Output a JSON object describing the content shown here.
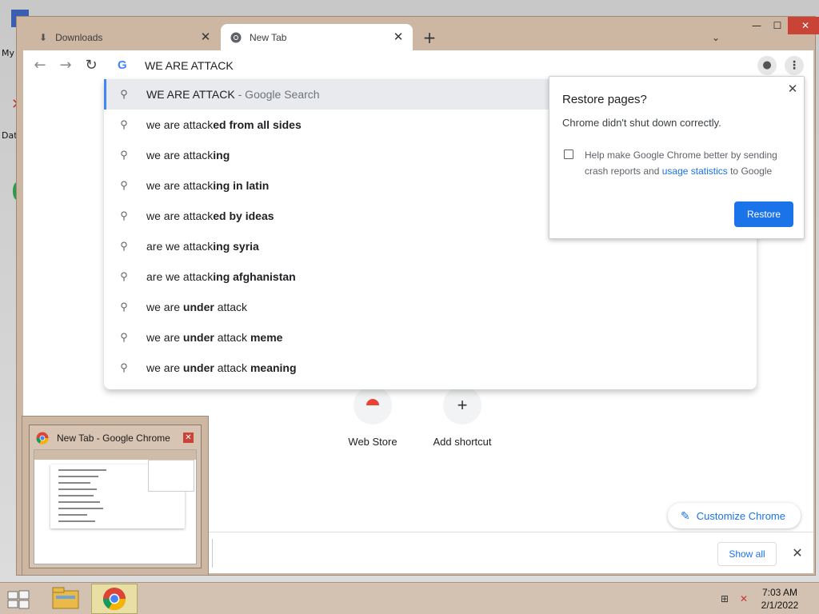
{
  "desktop": {
    "icon_labels": [
      "My",
      "Dat"
    ]
  },
  "window": {
    "tabs": [
      {
        "label": "Downloads",
        "icon": "download-icon"
      },
      {
        "label": "New Tab",
        "icon": "chrome-icon"
      }
    ],
    "controls": {
      "min": "—",
      "max": "☐",
      "close": "✕"
    }
  },
  "toolbar": {
    "omnibox_value": "WE ARE ATTACK"
  },
  "suggestions": [
    {
      "parts": [
        {
          "t": "WE ARE ATTACK",
          "b": false
        }
      ],
      "suffix": " - Google Search",
      "selected": true
    },
    {
      "parts": [
        {
          "t": "we are attack",
          "b": false
        },
        {
          "t": "ed from all sides",
          "b": true
        }
      ]
    },
    {
      "parts": [
        {
          "t": "we are attack",
          "b": false
        },
        {
          "t": "ing",
          "b": true
        }
      ]
    },
    {
      "parts": [
        {
          "t": "we are attack",
          "b": false
        },
        {
          "t": "ing in latin",
          "b": true
        }
      ]
    },
    {
      "parts": [
        {
          "t": "we are attack",
          "b": false
        },
        {
          "t": "ed by ideas",
          "b": true
        }
      ]
    },
    {
      "parts": [
        {
          "t": "are we attack",
          "b": false
        },
        {
          "t": "ing syria",
          "b": true
        }
      ]
    },
    {
      "parts": [
        {
          "t": "are we attack",
          "b": false
        },
        {
          "t": "ing afghanistan",
          "b": true
        }
      ]
    },
    {
      "parts": [
        {
          "t": "we are ",
          "b": false
        },
        {
          "t": "under",
          "b": true
        },
        {
          "t": " attack",
          "b": false
        }
      ]
    },
    {
      "parts": [
        {
          "t": "we are ",
          "b": false
        },
        {
          "t": "under",
          "b": true
        },
        {
          "t": " attack ",
          "b": false
        },
        {
          "t": "meme",
          "b": true
        }
      ]
    },
    {
      "parts": [
        {
          "t": "we are ",
          "b": false
        },
        {
          "t": "under",
          "b": true
        },
        {
          "t": " attack ",
          "b": false
        },
        {
          "t": "meaning",
          "b": true
        }
      ]
    }
  ],
  "restore_bubble": {
    "title": "Restore pages?",
    "message": "Chrome didn't shut down correctly.",
    "option_text_1": "Help make Google Chrome better by sending crash reports and ",
    "option_link": "usage statistics",
    "option_text_2": " to Google",
    "restore_label": "Restore"
  },
  "ntp": {
    "shortcuts": [
      {
        "label": "Web Store"
      },
      {
        "label": "Add shortcut"
      }
    ],
    "customize_label": "Customize Chrome"
  },
  "shelf": {
    "show_all_label": "Show all"
  },
  "thumbnail": {
    "title": "New Tab - Google Chrome"
  },
  "taskbar": {
    "time": "7:03 AM",
    "date": "2/1/2022"
  },
  "colors": {
    "accent": "#1a73e8",
    "frame": "#cdb7a3",
    "close_red": "#c94437"
  }
}
